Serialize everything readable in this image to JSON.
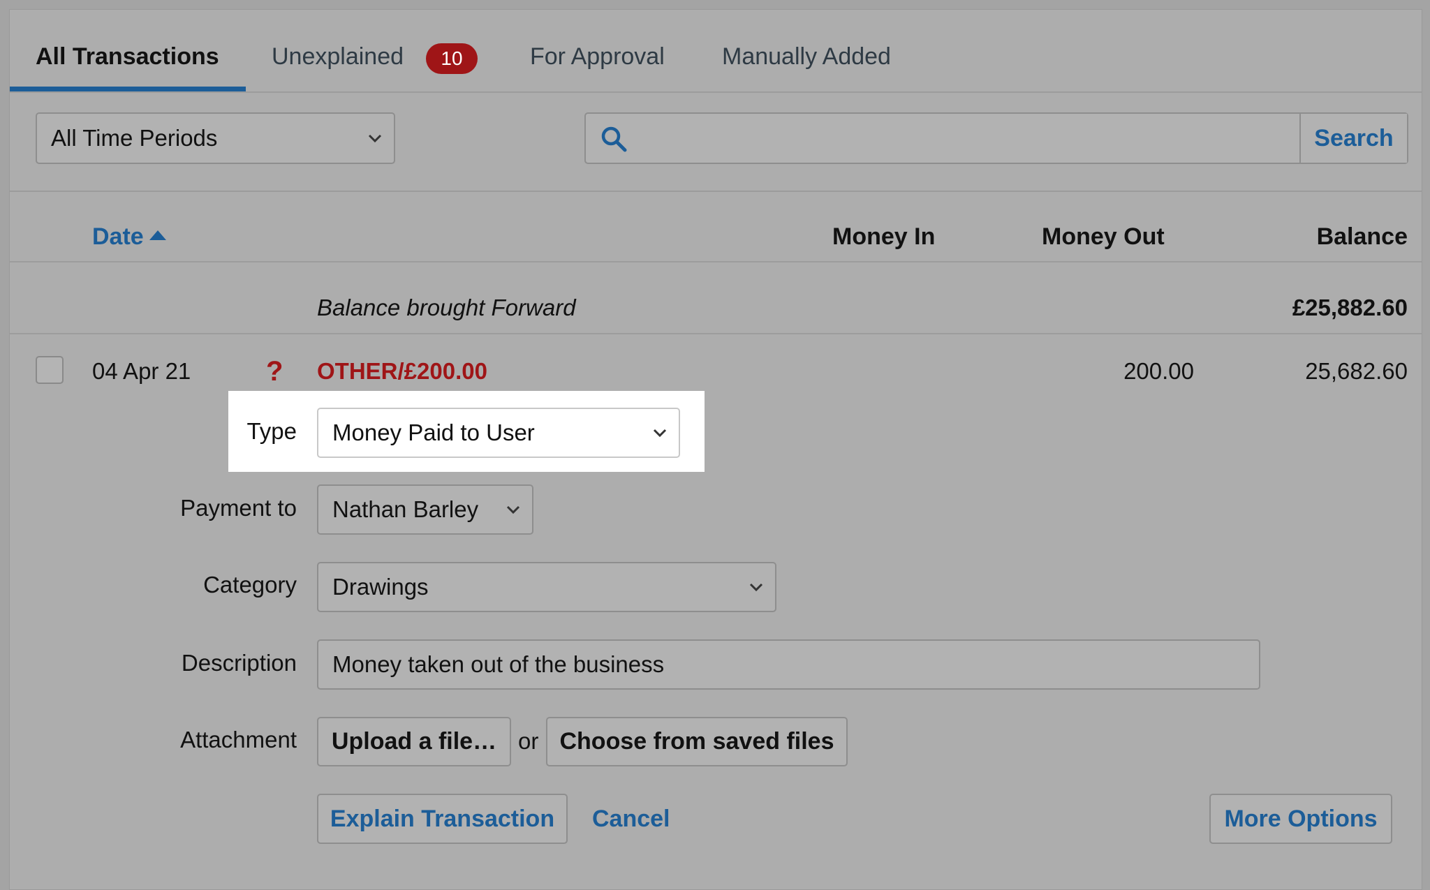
{
  "tabs": [
    {
      "label": "All Transactions"
    },
    {
      "label": "Unexplained",
      "badge": "10"
    },
    {
      "label": "For Approval"
    },
    {
      "label": "Manually Added"
    }
  ],
  "filters": {
    "period": "All Time Periods",
    "search_value": "",
    "search_button": "Search"
  },
  "table": {
    "columns": {
      "date": "Date",
      "money_in": "Money In",
      "money_out": "Money Out",
      "balance": "Balance"
    },
    "brought_forward": {
      "label": "Balance brought Forward",
      "balance": "£25,882.60"
    },
    "rows": [
      {
        "date": "04 Apr 21",
        "status_icon": "question-mark-icon",
        "description": "OTHER/£200.00",
        "money_in": "",
        "money_out": "200.00",
        "balance": "25,682.60"
      }
    ]
  },
  "form": {
    "type_label": "Type",
    "type_value": "Money Paid to User",
    "payment_to_label": "Payment to",
    "payment_to_value": "Nathan Barley",
    "category_label": "Category",
    "category_value": "Drawings",
    "description_label": "Description",
    "description_value": "Money taken out of the business",
    "attachment_label": "Attachment",
    "upload_button": "Upload a file…",
    "or_text": "or",
    "choose_saved_button": "Choose from saved files",
    "explain_button": "Explain Transaction",
    "cancel_link": "Cancel",
    "more_options_button": "More Options"
  },
  "colors": {
    "accent": "#1c5d98",
    "alert": "#9f1517",
    "overlay_background": "#adadad"
  }
}
